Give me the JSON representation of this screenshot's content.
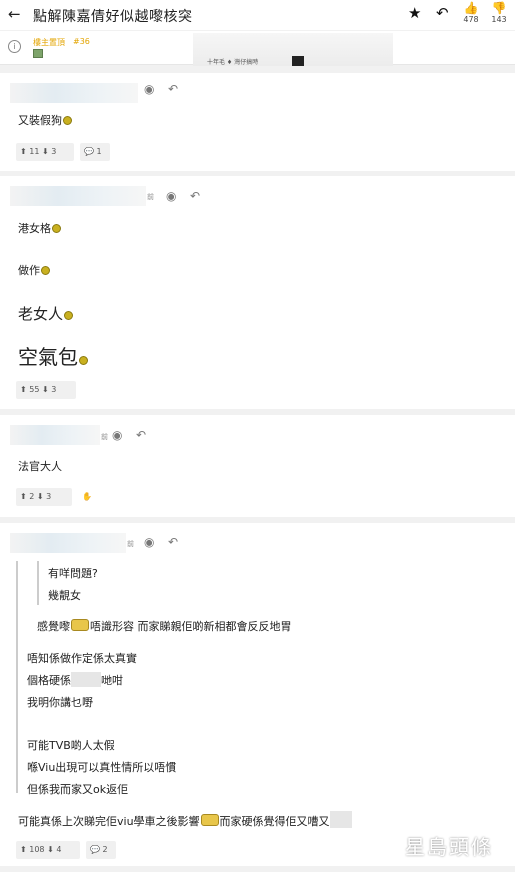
{
  "header": {
    "title": "點解陳嘉倩好似越嚟核突",
    "upvotes": "478",
    "downvotes": "143"
  },
  "info": {
    "op_label": "樓主置頂",
    "op_floor": "#36",
    "thumb_text": "十年毛 ♦ 灣仔搞時"
  },
  "posts": [
    {
      "lines": [
        "又裝假狗"
      ],
      "likes": "11",
      "dislikes": "3",
      "replies": "1"
    },
    {
      "time": "前",
      "lines": [
        "港女格",
        "做作",
        "老女人",
        "空氣包"
      ],
      "likes": "55",
      "dislikes": "3"
    },
    {
      "time": "前",
      "lines": [
        "法官大人"
      ],
      "likes": "2",
      "dislikes": "3"
    },
    {
      "time": "前",
      "quote_inner": [
        "有咩問題?",
        "幾靚女"
      ],
      "quote_outer_1": [
        "感覺嚟",
        "唔識形容 而家睇親佢啲新相都會反反地胃"
      ],
      "quote_outer_2": [
        "唔知係做作定係太真實",
        "個格硬係",
        "哋咁",
        "我明你講乜嘢"
      ],
      "quote_outer_3": [
        "可能TVB啲人太假",
        "喺Viu出現可以真性情所以唔慣",
        "但係我而家又ok返佢"
      ],
      "main": [
        "可能真係上次睇完佢viu學車之後影響",
        "而家硬係覺得佢又嘈又"
      ],
      "likes": "108",
      "dislikes": "4",
      "replies": "2"
    }
  ],
  "watermark": "星島頭條"
}
